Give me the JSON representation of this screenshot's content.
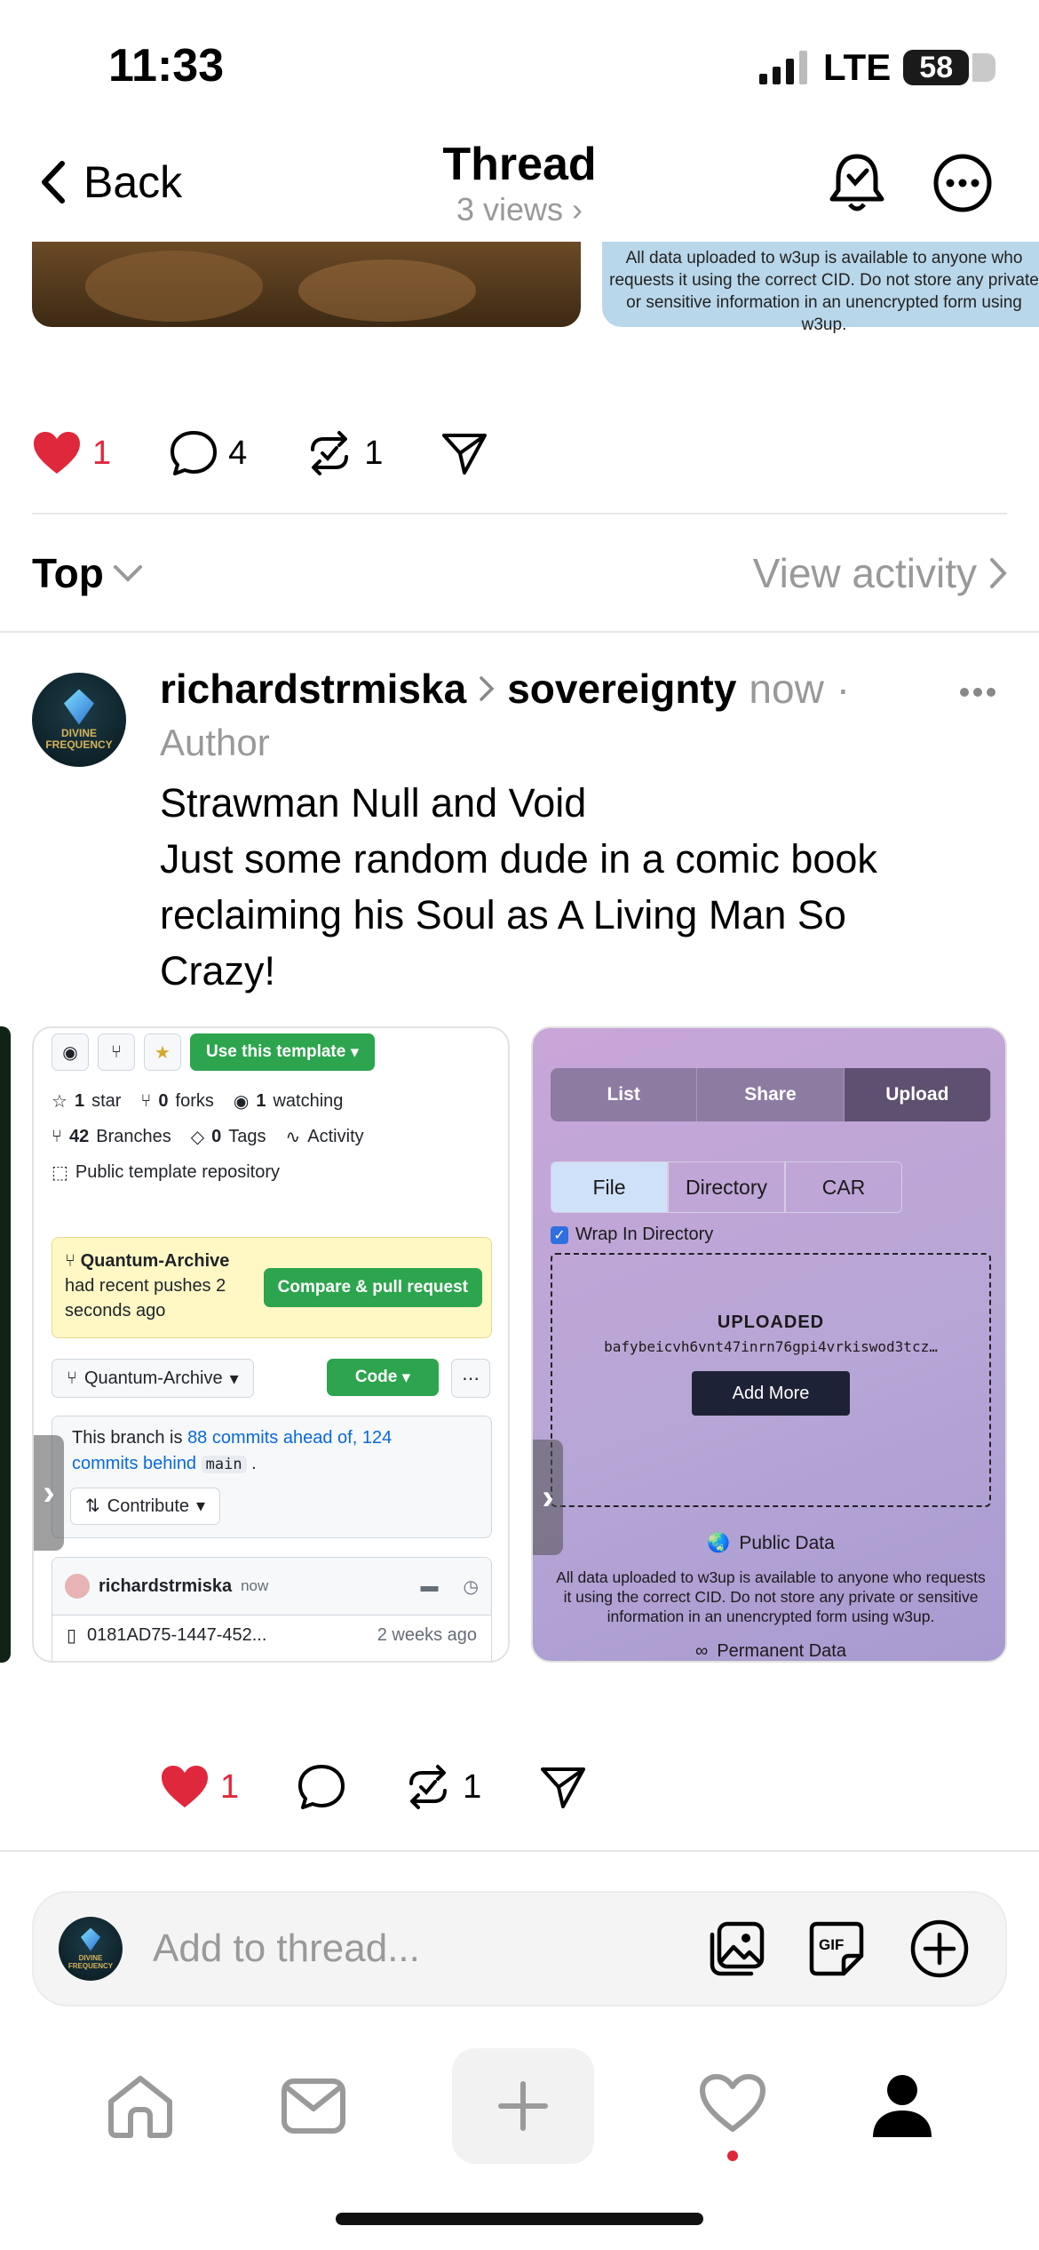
{
  "status_bar": {
    "time": "11:33",
    "network": "LTE",
    "battery": "58"
  },
  "header": {
    "back_label": "Back",
    "title": "Thread",
    "views": "3 views"
  },
  "top_post": {
    "image_right_text": "All data uploaded to w3up is available to anyone who requests it using the correct CID. Do not store any private or sensitive information in an unencrypted form using w3up.",
    "likes": "1",
    "comments": "4",
    "reposts": "1"
  },
  "sort": {
    "label": "Top",
    "view_activity": "View activity"
  },
  "post": {
    "avatar_text": "DIVINE FREQUENCY",
    "username": "richardstrmiska",
    "community": "sovereignty",
    "time": "now",
    "author_tag": "Author",
    "title": "Strawman Null and Void",
    "body": "Just some random dude in a comic book reclaiming his Soul as A Living Man So Crazy!",
    "likes": "1",
    "reposts": "1"
  },
  "github_card": {
    "use_template": "Use this template",
    "stars": "1",
    "star_label": "star",
    "forks": "0",
    "forks_label": "forks",
    "watching": "1",
    "watching_label": "watching",
    "branches": "42",
    "branches_label": "Branches",
    "tags": "0",
    "tags_label": "Tags",
    "activity": "Activity",
    "public_template": "Public template repository",
    "push_branch": "Quantum-Archive",
    "push_text": "had recent pushes 2 seconds ago",
    "compare_btn": "Compare & pull request",
    "branch_select": "Quantum-Archive",
    "code_btn": "Code",
    "branch_status_prefix": "This branch is",
    "ahead": "88 commits ahead of,",
    "behind": "124 commits behind",
    "main": "main",
    "contribute": "Contribute",
    "commit_user": "richardstrmiska",
    "commit_time": "now",
    "file_name": "0181AD75-1447-452...",
    "file_time": "2 weeks ago"
  },
  "w3_card": {
    "tabs": [
      "List",
      "Share",
      "Upload"
    ],
    "segments": [
      "File",
      "Directory",
      "CAR"
    ],
    "wrap_label": "Wrap In Directory",
    "uploaded": "UPLOADED",
    "cid": "bafybeicvh6vnt47inrn76gpi4vrkiswod3tcz…",
    "add_more": "Add More",
    "public_data": "Public Data",
    "notice": "All data uploaded to w3up is available to anyone who requests it using the correct CID. Do not store any private or sensitive information in an unencrypted form using w3up.",
    "permanent": "Permanent Data"
  },
  "compose": {
    "placeholder": "Add to thread..."
  },
  "colors": {
    "like_red": "#e0283c",
    "gh_green": "#2da44e",
    "link_blue": "#0969da"
  }
}
